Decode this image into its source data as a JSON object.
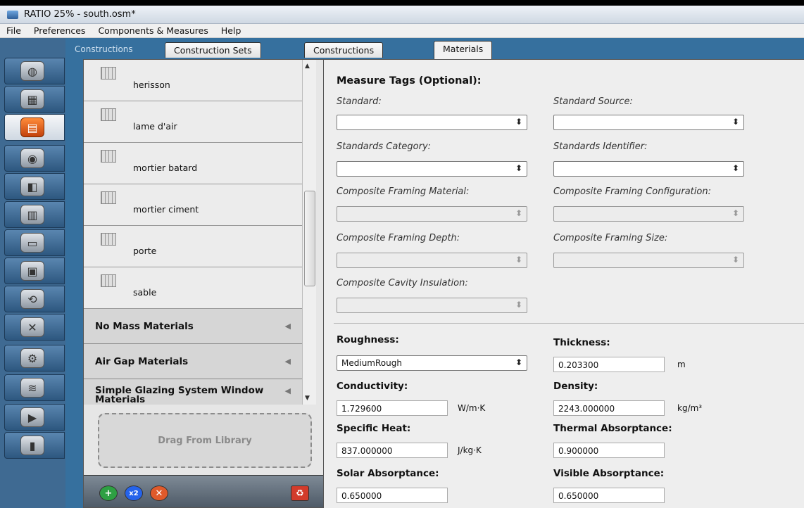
{
  "window": {
    "title": "RATIO 25% - south.osm*"
  },
  "menu": [
    "File",
    "Preferences",
    "Components & Measures",
    "Help"
  ],
  "tabs": {
    "caption": "Constructions",
    "items": [
      "Construction Sets",
      "Constructions",
      "Materials"
    ],
    "selected": "Materials"
  },
  "sidebar_icons": [
    "globe-icon",
    "calendar-icon",
    "bricks-icon",
    "outlet-icon",
    "building-block-icon",
    "skyscraper-icon",
    "floor-slab-icon",
    "cube-icon",
    "loop-icon",
    "variables-icon",
    "gears-icon",
    "scroll-icon",
    "play-icon",
    "bar-chart-icon"
  ],
  "list": {
    "items": [
      "herisson",
      "lame d'air",
      "mortier batard",
      "mortier ciment",
      "porte",
      "sable"
    ],
    "groups": [
      "No Mass Materials",
      "Air Gap Materials",
      "Simple Glazing System Window Materials"
    ],
    "drop_zone": "Drag From Library"
  },
  "form": {
    "measure_tags_title": "Measure Tags (Optional):",
    "standard": "Standard:",
    "standard_source": "Standard Source:",
    "standards_category": "Standards Category:",
    "standards_identifier": "Standards Identifier:",
    "composite_framing_material": "Composite Framing Material:",
    "composite_framing_configuration": "Composite Framing Configuration:",
    "composite_framing_depth": "Composite Framing Depth:",
    "composite_framing_size": "Composite Framing Size:",
    "composite_cavity_insulation": "Composite Cavity Insulation:",
    "roughness": {
      "label": "Roughness:",
      "value": "MediumRough"
    },
    "thickness": {
      "label": "Thickness:",
      "value": "0.203300",
      "unit": "m"
    },
    "conductivity": {
      "label": "Conductivity:",
      "value": "1.729600",
      "unit": "W/m·K"
    },
    "density": {
      "label": "Density:",
      "value": "2243.000000",
      "unit": "kg/m³"
    },
    "specific_heat": {
      "label": "Specific Heat:",
      "value": "837.000000",
      "unit": "J/kg·K"
    },
    "thermal_absorptance": {
      "label": "Thermal Absorptance:",
      "value": "0.900000"
    },
    "solar_absorptance": {
      "label": "Solar Absorptance:",
      "value": "0.650000"
    },
    "visible_absorptance": {
      "label": "Visible Absorptance:",
      "value": "0.650000"
    }
  },
  "colors": {
    "accent": "#36709e",
    "add": "#2ea043",
    "copy": "#2563eb",
    "delete": "#e05a2b",
    "purge": "#d23b2b"
  }
}
